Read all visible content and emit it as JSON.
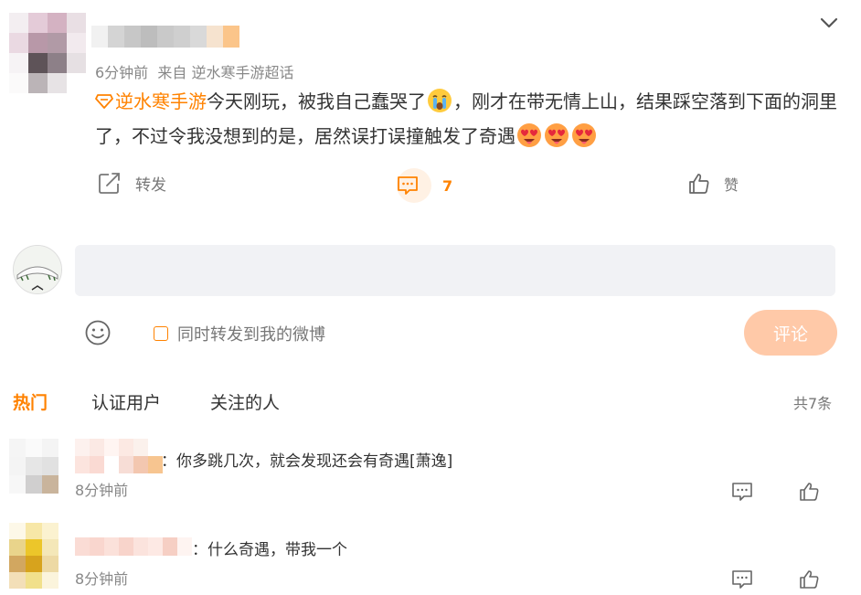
{
  "post": {
    "meta_time": "6分钟前",
    "meta_source": "来自 逆水寒手游超话",
    "topic": "逆水寒手游",
    "text_part1": "今天刚玩，被我自己蠢哭了",
    "text_part2": "，刚才在带无情上山，结果踩空落到下面的洞里了，不过令我没想到的是，居然误打误撞触发了奇遇",
    "emojis": [
      "crying-emoji",
      "heart-eyes-emoji",
      "heart-eyes-emoji",
      "heart-eyes-emoji"
    ]
  },
  "actions": {
    "repost_label": "转发",
    "comment_count": "7",
    "like_label": "赞"
  },
  "composer": {
    "input_value": "",
    "sync_label": "同时转发到我的微博",
    "submit_label": "评论"
  },
  "tabs": [
    {
      "label": "热门",
      "active": true
    },
    {
      "label": "认证用户",
      "active": false
    },
    {
      "label": "关注的人",
      "active": false
    }
  ],
  "total": "共7条",
  "comments": [
    {
      "text": "：你多跳几次，就会发现还会有奇遇[萧逸]",
      "time": "8分钟前"
    },
    {
      "text": "：什么奇遇，带我一个",
      "time": "8分钟前"
    }
  ],
  "colors": {
    "accent": "#ff8200",
    "submit_disabled": "#ffc9a8",
    "input_bg": "#f1f2f5"
  }
}
